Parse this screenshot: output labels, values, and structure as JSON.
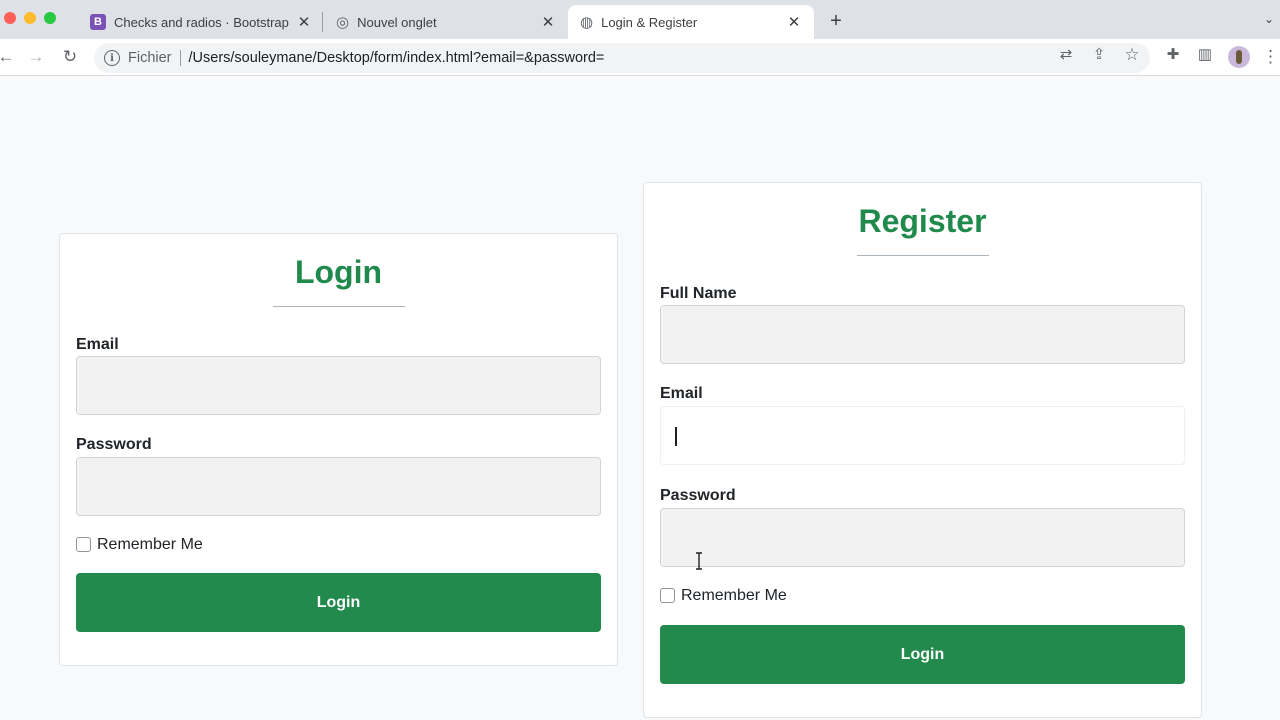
{
  "browser": {
    "tabs": [
      {
        "title": "Checks and radios · Bootstrap",
        "icon": "bootstrap-icon",
        "active": false
      },
      {
        "title": "Nouvel onglet",
        "icon": "chrome-icon",
        "active": false
      },
      {
        "title": "Login & Register",
        "icon": "globe-icon",
        "active": true
      }
    ],
    "address": {
      "scheme": "Fichier",
      "url": "/Users/souleymane/Desktop/form/index.html?email=&password="
    },
    "icons": {
      "close": "✕",
      "new_tab": "+",
      "back": "←",
      "forward": "→",
      "reload": "↻",
      "info": "i",
      "translate": "⇄",
      "share": "⇪",
      "star": "☆",
      "extensions": "✚",
      "side_panel": "▥",
      "menu": "⋮",
      "tab_menu": "⌄",
      "bootstrap": "B",
      "chrome": "◎",
      "globe": "◍"
    }
  },
  "login": {
    "title": "Login",
    "email_label": "Email",
    "password_label": "Password",
    "remember_label": "Remember Me",
    "submit_label": "Login"
  },
  "register": {
    "title": "Register",
    "fullname_label": "Full Name",
    "email_label": "Email",
    "password_label": "Password",
    "remember_label": "Remember Me",
    "submit_label": "Login"
  },
  "colors": {
    "accent_green": "#1f8a4c",
    "button_green": "#218a4c",
    "page_background": "#f8f9fa",
    "input_background": "#f2f2f2"
  }
}
